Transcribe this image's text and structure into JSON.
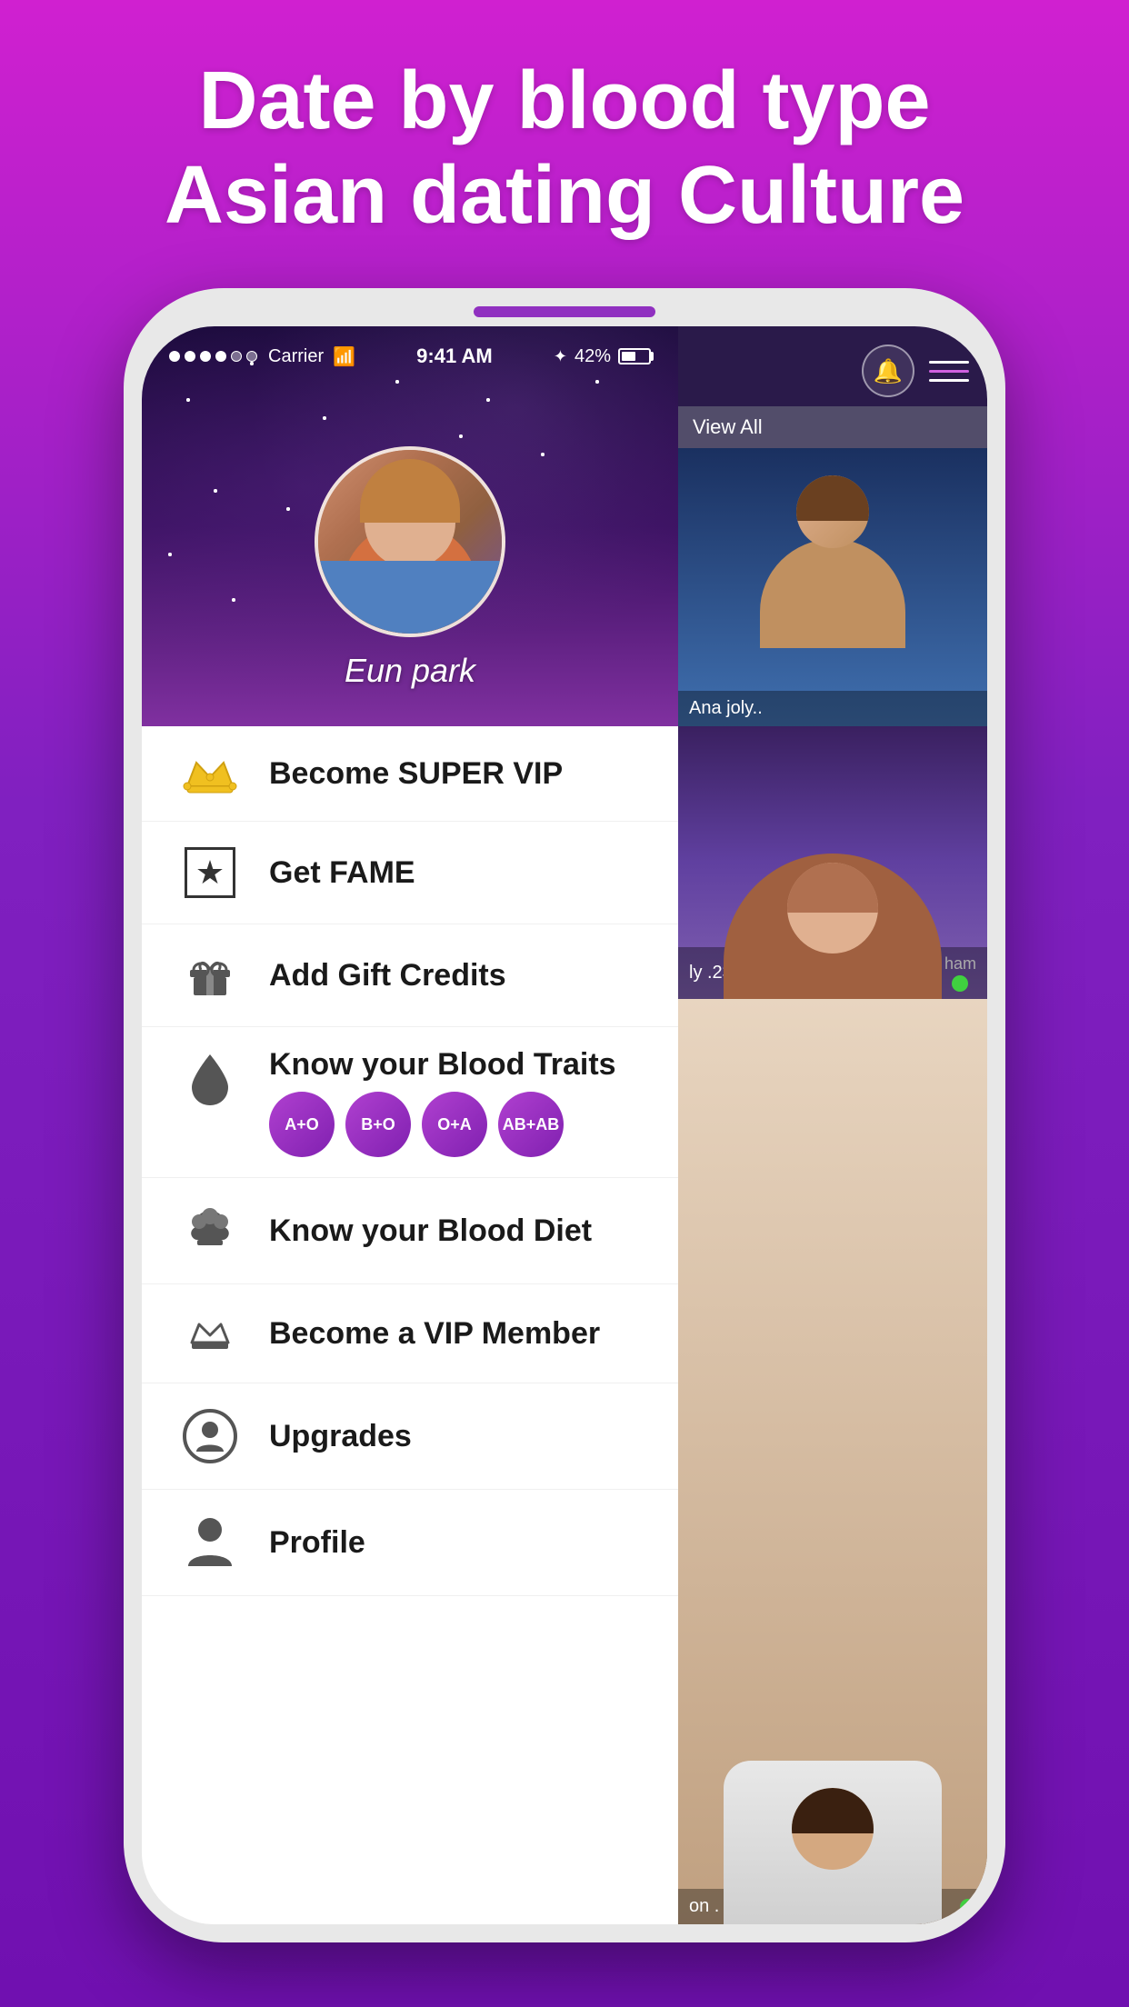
{
  "app": {
    "title_line1": "Date by blood type",
    "title_line2": "Asian dating Culture"
  },
  "status_bar": {
    "carrier": "Carrier",
    "time": "9:41 AM",
    "battery_percent": "42%",
    "bt_symbol": "✦",
    "signal_dots": [
      "filled",
      "filled",
      "filled",
      "filled",
      "empty",
      "empty"
    ]
  },
  "profile": {
    "name": "Eun park",
    "right_label": "View All",
    "right_person_name": "Ana joly.."
  },
  "menu": {
    "items": [
      {
        "id": "super-vip",
        "label": "Become SUPER VIP",
        "icon": "crown-gold"
      },
      {
        "id": "fame",
        "label": "Get FAME",
        "icon": "star-box"
      },
      {
        "id": "gift",
        "label": "Add Gift Credits",
        "icon": "gift"
      },
      {
        "id": "blood-traits",
        "label": "Know your Blood Traits",
        "icon": "blood-drop",
        "pills": [
          "A+O",
          "B+O",
          "O+A",
          "AB+AB"
        ]
      },
      {
        "id": "blood-diet",
        "label": "Know your  Blood Diet",
        "icon": "chef-hat"
      },
      {
        "id": "vip-member",
        "label": "Become a VIP Member",
        "icon": "vip-crown"
      },
      {
        "id": "upgrades",
        "label": "Upgrades",
        "icon": "person-circle"
      },
      {
        "id": "profile",
        "label": "Profile",
        "icon": "person-silhouette"
      }
    ]
  },
  "right_cards": [
    {
      "name": "Ana joly..",
      "age": ""
    },
    {
      "name": "ly .23",
      "location": "ham",
      "online": true
    },
    {
      "name": "on . 23",
      "online": true
    }
  ]
}
